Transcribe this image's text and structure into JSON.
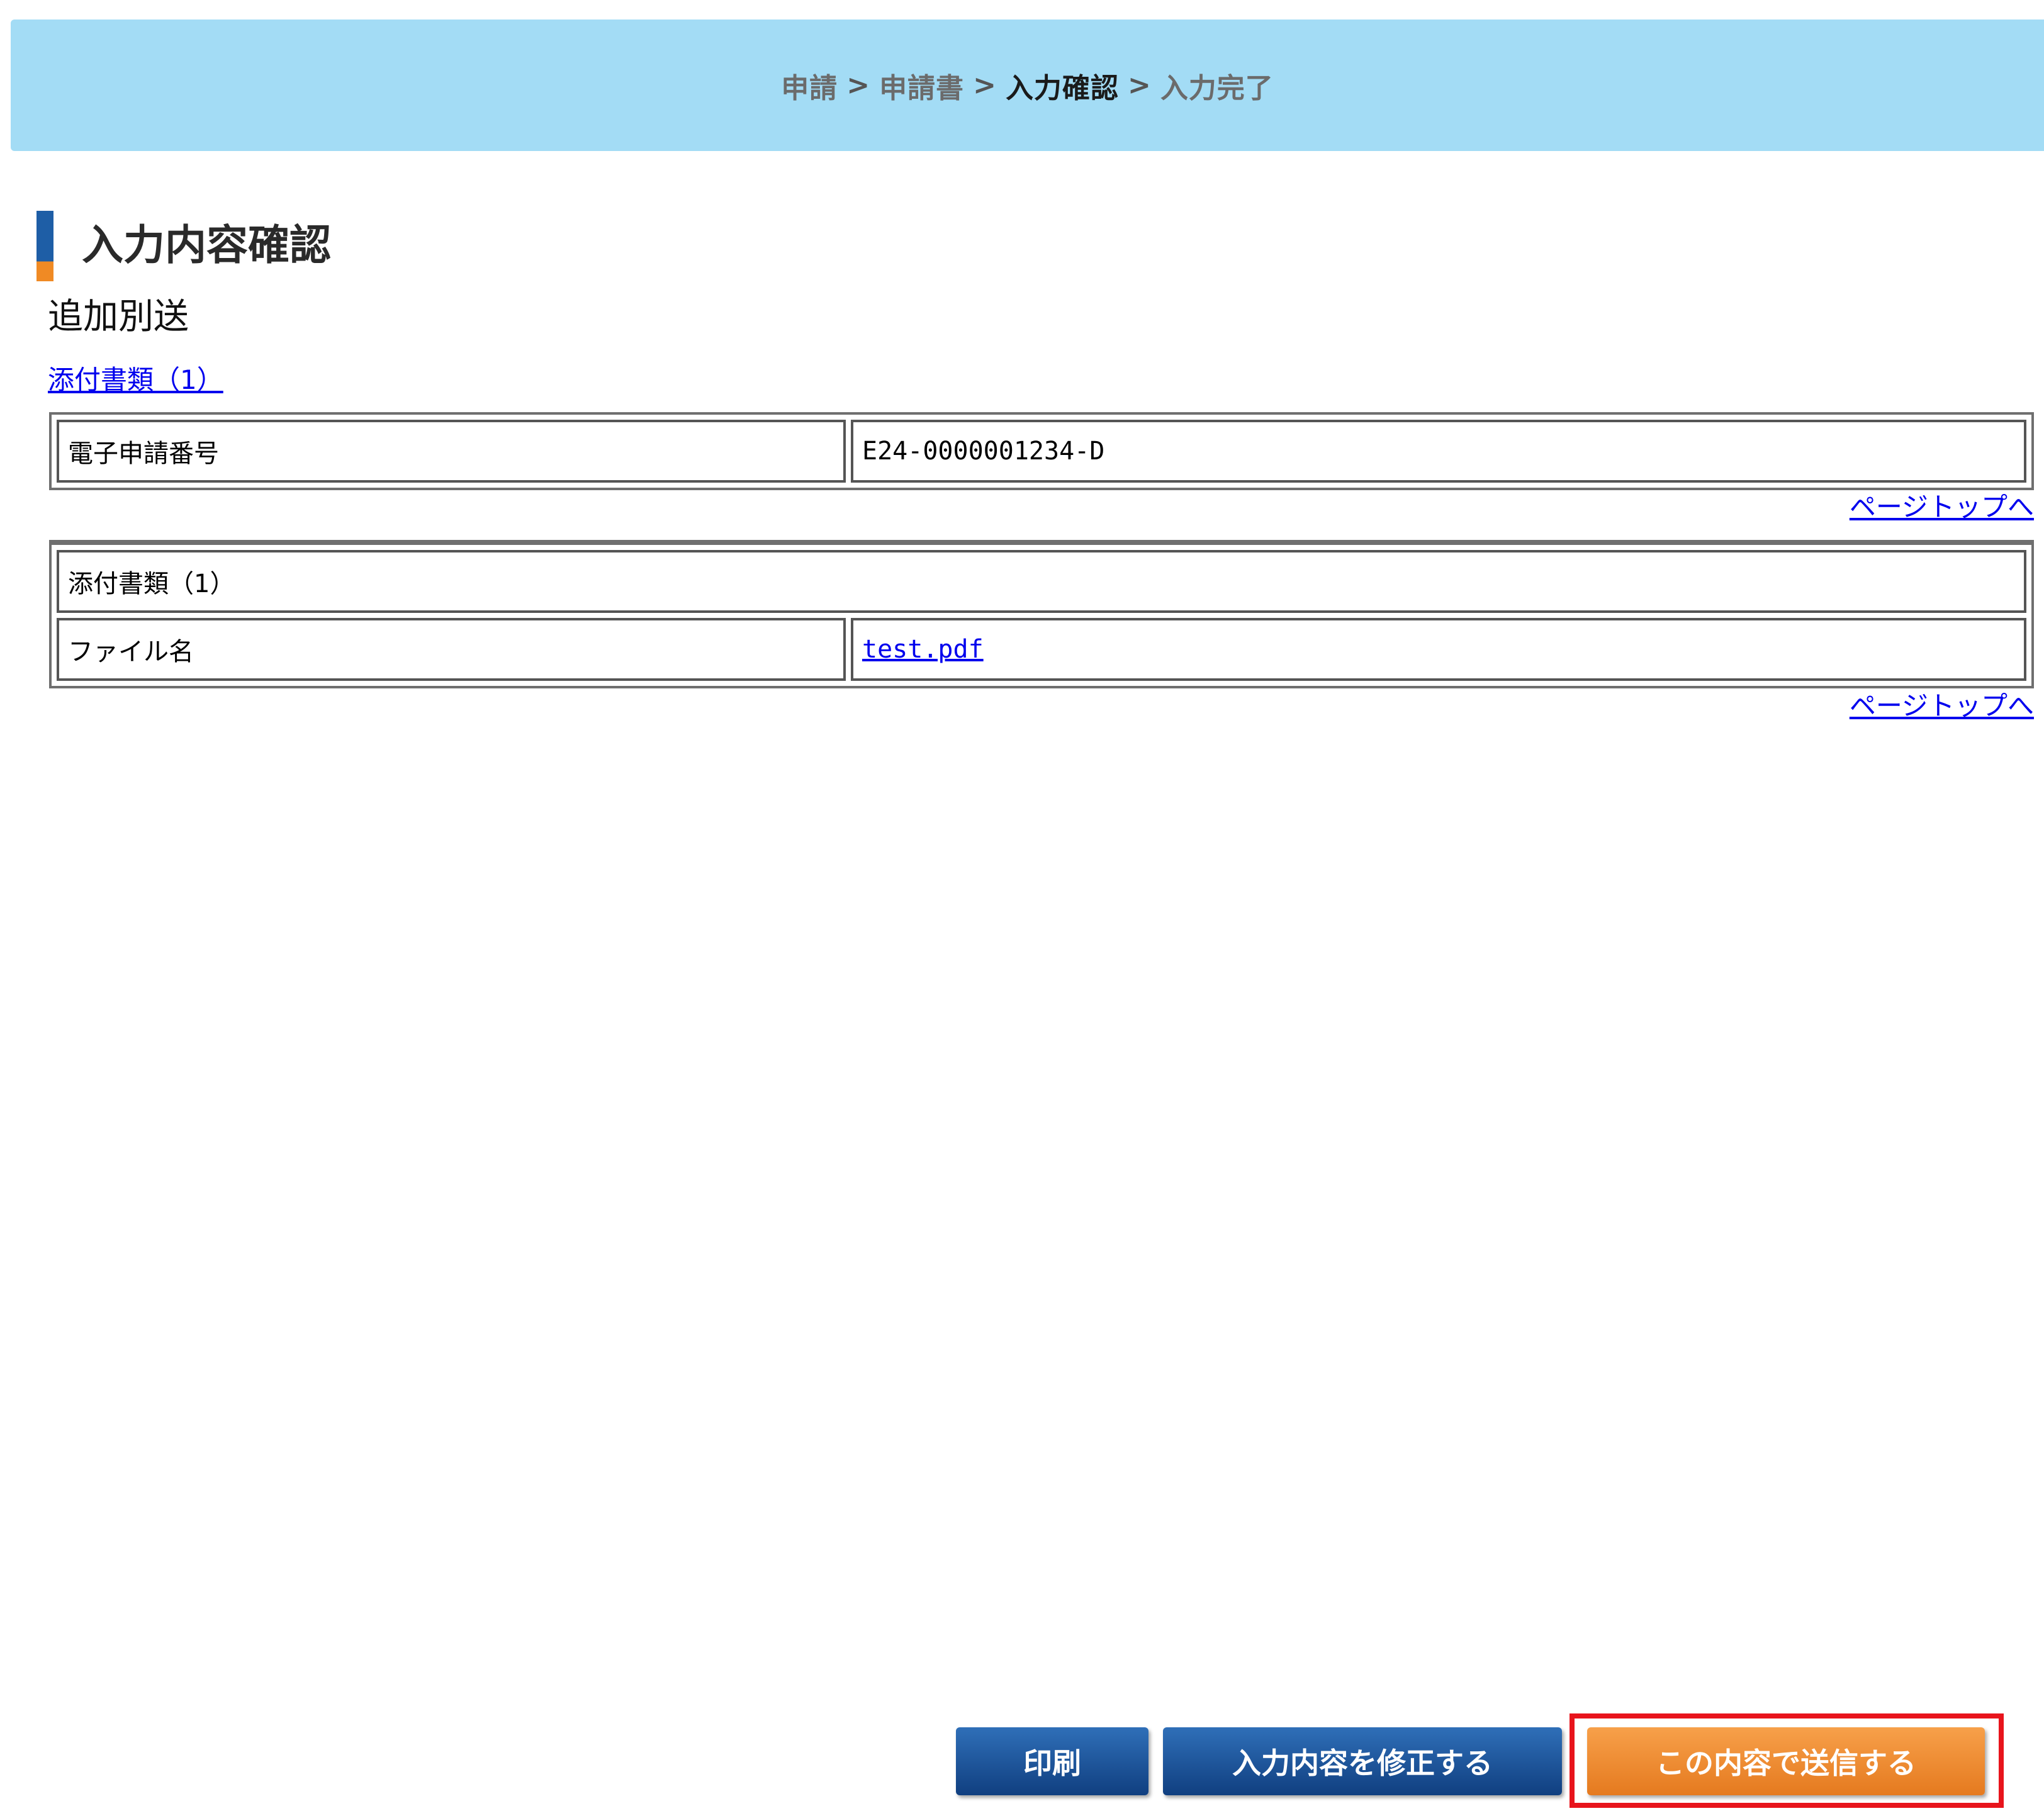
{
  "breadcrumb": {
    "items": [
      "申請",
      "申請書",
      "入力確認",
      "入力完了"
    ],
    "separator": ">",
    "current_index": 2
  },
  "page": {
    "title": "入力内容確認",
    "subtitle": "追加別送",
    "attachments_link": "添付書類（1）"
  },
  "table1": {
    "rows": [
      {
        "label": "電子申請番号",
        "value": "E24-0000001234-D"
      }
    ]
  },
  "table2": {
    "section_title": "添付書類（1）",
    "rows": [
      {
        "label": "ファイル名",
        "value": "test.pdf"
      }
    ]
  },
  "pagetop_label": "ページトップへ",
  "buttons": {
    "print": "印刷",
    "edit": "入力内容を修正する",
    "send": "この内容で送信する"
  },
  "colors": {
    "breadcrumb_bg": "#a3dcf5",
    "primary_button": "#1e5ea6",
    "send_button": "#f08a24",
    "highlight": "#e8141c",
    "link": "#0000ee"
  }
}
